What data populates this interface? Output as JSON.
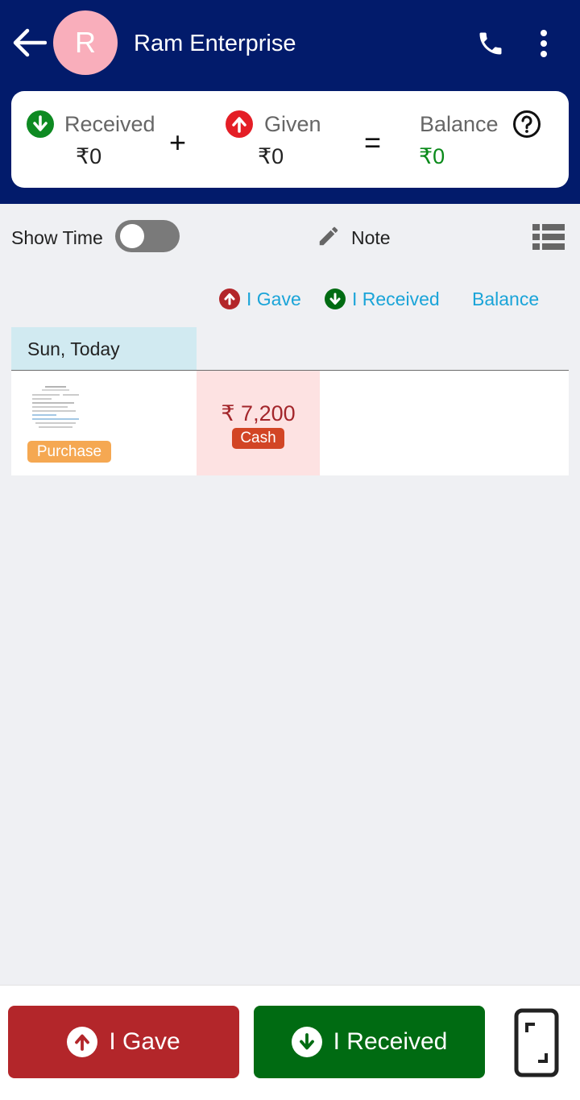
{
  "header": {
    "avatar_letter": "R",
    "title": "Ram Enterprise",
    "back_icon": "arrow-left-icon",
    "phone_icon": "phone-icon",
    "menu_icon": "more-vertical-icon"
  },
  "summary": {
    "received_label": "Received",
    "received_value": "₹0",
    "plus": "+",
    "given_label": "Given",
    "given_value": "₹0",
    "equals": "=",
    "balance_label": "Balance",
    "balance_value": "₹0"
  },
  "toolbar": {
    "show_time_label": "Show Time",
    "show_time_on": false,
    "note_label": "Note"
  },
  "columns": {
    "gave": "I Gave",
    "received": "I Received",
    "balance": "Balance"
  },
  "ledger": {
    "date_label": "Sun, Today",
    "entries": [
      {
        "tag": "Purchase",
        "amount": "₹ 7,200",
        "mode": "Cash"
      }
    ]
  },
  "actions": {
    "gave_button": "I Gave",
    "received_button": "I Received"
  },
  "colors": {
    "header_bg": "#021b6b",
    "gave_red": "#b3262a",
    "received_green": "#006b12",
    "balance_green": "#0a8a1a",
    "link_blue": "#1aa4d8",
    "purchase_orange": "#f5a852",
    "cash_red": "#d24525"
  }
}
